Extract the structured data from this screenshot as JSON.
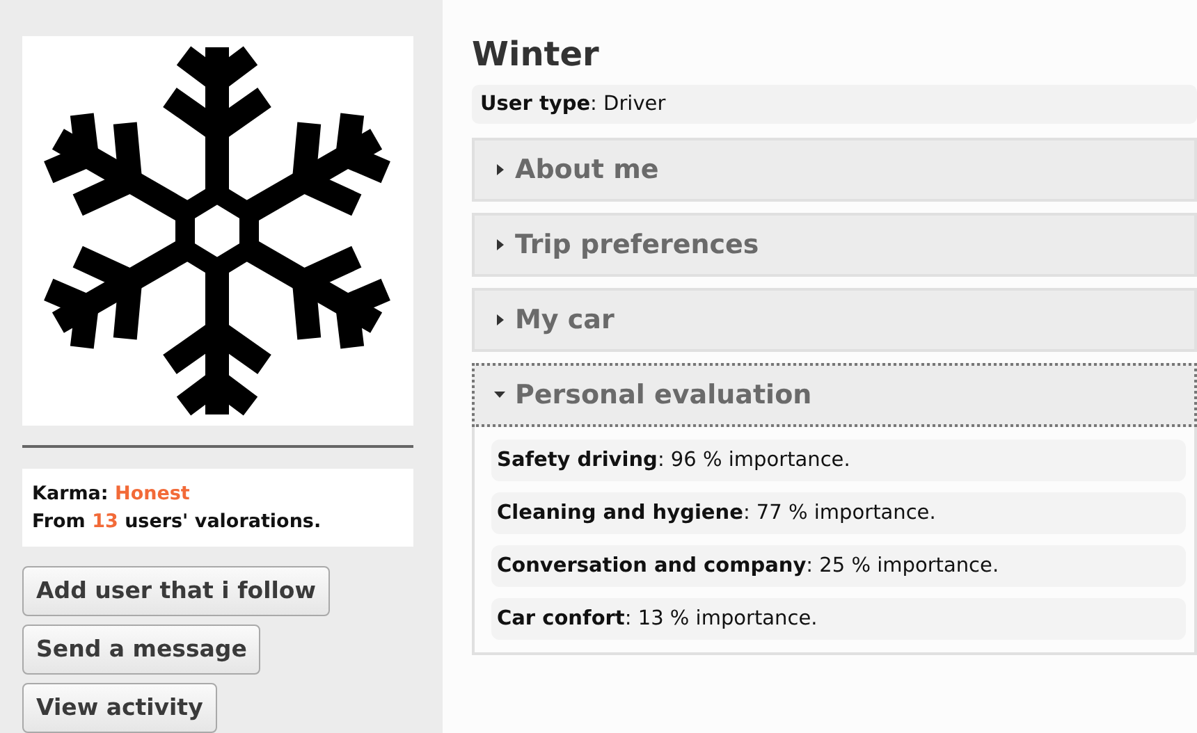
{
  "profile": {
    "karma_label": "Karma:",
    "karma_value": "Honest",
    "from_label": "From",
    "count": "13",
    "count_suffix": "users' valorations."
  },
  "actions": [
    "Add user that i follow",
    "Send a message",
    "View activity"
  ],
  "title": "Winter",
  "user_type": "**User type**: Driver",
  "sections": [
    {
      "label": "About me",
      "expanded": false
    },
    {
      "label": "Trip preferences",
      "expanded": false
    },
    {
      "label": "My car",
      "expanded": false
    },
    {
      "label": "Personal evaluation",
      "expanded": true,
      "items": [
        "**Safety driving**: 96 % importance.",
        "**Cleaning and hygiene**: 77 % importance.",
        "**Conversation and company**: 25 % importance.",
        "**Car confort**: 13 % importance."
      ]
    }
  ]
}
